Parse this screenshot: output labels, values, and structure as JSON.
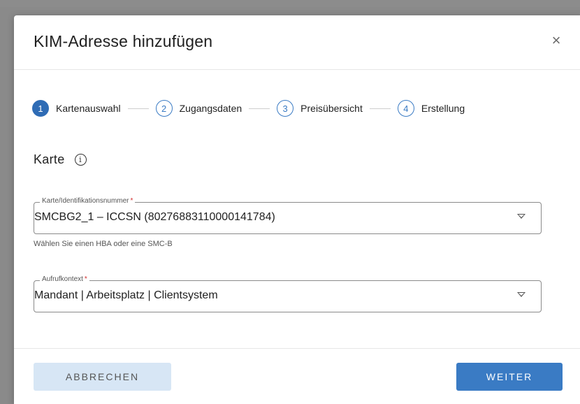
{
  "dialog": {
    "title": "KIM-Adresse hinzufügen",
    "close_symbol": "×"
  },
  "stepper": {
    "steps": [
      {
        "number": "1",
        "label": "Kartenauswahl",
        "active": true
      },
      {
        "number": "2",
        "label": "Zugangsdaten",
        "active": false
      },
      {
        "number": "3",
        "label": "Preisübersicht",
        "active": false
      },
      {
        "number": "4",
        "label": "Erstellung",
        "active": false
      }
    ]
  },
  "section": {
    "title": "Karte",
    "info_symbol": "i"
  },
  "fields": {
    "card": {
      "label": "Karte/Identifikationsnummer",
      "required_marker": "*",
      "value": "SMCBG2_1 – ICCSN (80276883110000141784)",
      "hint": "Wählen Sie einen HBA oder eine SMC-B"
    },
    "context": {
      "label": "Aufrufkontext",
      "required_marker": "*",
      "value": "Mandant | Arbeitsplatz | Clientsystem"
    }
  },
  "footer": {
    "cancel_label": "ABBRECHEN",
    "next_label": "WEITER"
  },
  "colors": {
    "accent": "#3a7bc4",
    "cancel_bg": "#d7e6f5",
    "required": "#d32f2f"
  }
}
